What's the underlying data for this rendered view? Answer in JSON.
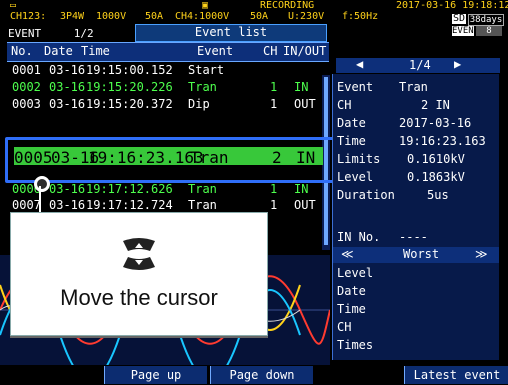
{
  "status": {
    "channel": "CH123:",
    "wiring": "3P4W",
    "voltage": "1000V",
    "current": "50A",
    "current_mark": "CH4:1000V",
    "current2": "50A",
    "u": "U:230V",
    "freq": "f:50Hz",
    "recording": "RECORDING",
    "datetime": "2017-03-16 19:18:12",
    "sd": "SD",
    "days": "38days",
    "event_label": "EVENT",
    "event_count": "8"
  },
  "tab": {
    "left_title": "EVENT",
    "left_page": "1/2",
    "main_title": "Event list"
  },
  "list": {
    "headers": [
      "No.",
      "Date",
      "Time",
      "Event",
      "CH",
      "IN/OUT"
    ],
    "rows": [
      {
        "no": "0001",
        "date": "03-16",
        "time": "19:15:00.152",
        "event": "Start",
        "ch": "",
        "io": ""
      },
      {
        "no": "0002",
        "date": "03-16",
        "time": "19:15:20.226",
        "event": "Tran",
        "ch": "1",
        "io": "IN"
      },
      {
        "no": "0003",
        "date": "03-16",
        "time": "19:15:20.372",
        "event": "Dip",
        "ch": "1",
        "io": "OUT"
      },
      {
        "no": "0005",
        "date": "03-16",
        "time": "19:16:23.163",
        "event": "Tran",
        "ch": "2",
        "io": "IN"
      },
      {
        "no": "0006",
        "date": "03-16",
        "time": "19:17:12.626",
        "event": "Tran",
        "ch": "1",
        "io": "IN"
      },
      {
        "no": "0007",
        "date": "03-16",
        "time": "19:17:12.724",
        "event": "Tran",
        "ch": "1",
        "io": "OUT"
      }
    ],
    "selected_index": 3
  },
  "detail": {
    "page": "1/4",
    "event_label": "Event",
    "event_value": "Tran",
    "ch_label": "CH",
    "ch_value": "2  IN",
    "date_label": "Date",
    "date_value": "2017-03-16",
    "time_label": "Time",
    "time_value": "19:16:23.163",
    "limits_label": "Limits",
    "limits_value": "0.1610kV",
    "level_label": "Level",
    "level_value": "0.1863kV",
    "duration_label": "Duration",
    "duration_value": "5us",
    "in_no_label": "IN No.",
    "in_no_value": "----",
    "worst_label": "Worst",
    "level2_label": "Level",
    "date2_label": "Date",
    "time2_label": "Time",
    "ch2_label": "CH",
    "times_label": "Times"
  },
  "popup": {
    "label": "Move the cursor"
  },
  "softkeys": {
    "page_up": "Page up",
    "page_down": "Page down",
    "latest_event": "Latest event"
  }
}
